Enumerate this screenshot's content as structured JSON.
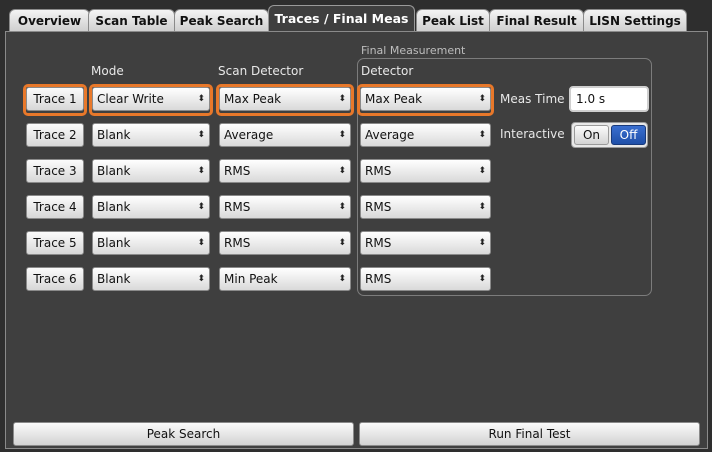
{
  "tabs": [
    {
      "label": "Overview"
    },
    {
      "label": "Scan Table"
    },
    {
      "label": "Peak Search"
    },
    {
      "label": "Traces / Final Meas"
    },
    {
      "label": "Peak List"
    },
    {
      "label": "Final Result"
    },
    {
      "label": "LISN Settings"
    }
  ],
  "active_tab": "Traces / Final Meas",
  "headers": {
    "mode": "Mode",
    "scan_detector": "Scan Detector",
    "final_group": "Final Measurement",
    "detector": "Detector"
  },
  "traces": [
    {
      "label": "Trace 1",
      "mode": "Clear Write",
      "scan_detector": "Max Peak",
      "final_detector": "Max Peak",
      "selected": true
    },
    {
      "label": "Trace 2",
      "mode": "Blank",
      "scan_detector": "Average",
      "final_detector": "Average",
      "selected": false
    },
    {
      "label": "Trace 3",
      "mode": "Blank",
      "scan_detector": "RMS",
      "final_detector": "RMS",
      "selected": false
    },
    {
      "label": "Trace 4",
      "mode": "Blank",
      "scan_detector": "RMS",
      "final_detector": "RMS",
      "selected": false
    },
    {
      "label": "Trace 5",
      "mode": "Blank",
      "scan_detector": "RMS",
      "final_detector": "RMS",
      "selected": false
    },
    {
      "label": "Trace 6",
      "mode": "Blank",
      "scan_detector": "Min Peak",
      "final_detector": "RMS",
      "selected": false
    }
  ],
  "meas_time": {
    "label": "Meas Time",
    "value": "1.0 s"
  },
  "interactive": {
    "label": "Interactive",
    "on_label": "On",
    "off_label": "Off",
    "value": "Off"
  },
  "buttons": {
    "peak_search": "Peak Search",
    "run_final_test": "Run Final Test"
  },
  "colors": {
    "highlight": "#e8782a",
    "toggle_active": "#1f4fa8",
    "panel_bg": "#3f3f3f"
  }
}
